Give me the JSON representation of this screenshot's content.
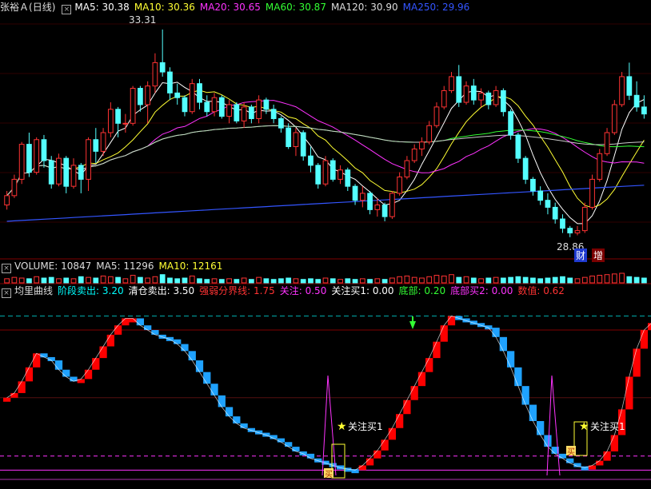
{
  "price_panel": {
    "symbol": "张裕Ａ",
    "period": "(日线)",
    "ma": [
      {
        "label": "MA5: 30.38",
        "color": "#ffffff"
      },
      {
        "label": "MA10: 30.36",
        "color": "#ffff33"
      },
      {
        "label": "MA20: 30.65",
        "color": "#ff33ff"
      },
      {
        "label": "MA60: 30.87",
        "color": "#33ff33"
      },
      {
        "label": "MA120: 30.90",
        "color": "#dddddd"
      },
      {
        "label": "MA250: 29.96",
        "color": "#3355ff"
      }
    ],
    "high_label": "33.31",
    "low_label": "28.86",
    "tag_cai": "财",
    "tag_zeng": "增"
  },
  "volume_panel": {
    "items": [
      {
        "label": "VOLUME: 10847",
        "color": "#dddddd"
      },
      {
        "label": "MA5: 11296",
        "color": "#dddddd"
      },
      {
        "label": "MA10: 12161",
        "color": "#ffff33"
      }
    ]
  },
  "indicator_panel": {
    "items": [
      {
        "label": "均里曲线",
        "color": "#dddddd"
      },
      {
        "label": "阶段卖出: 3.20",
        "color": "#00ffff"
      },
      {
        "label": "清仓卖出: 3.50",
        "color": "#ffffff"
      },
      {
        "label": "强弱分界线: 1.75",
        "color": "#ff3333"
      },
      {
        "label": "关注: 0.50",
        "color": "#ff33ff"
      },
      {
        "label": "关注买1: 0.00",
        "color": "#ffffff"
      },
      {
        "label": "底部: 0.20",
        "color": "#33ff33"
      },
      {
        "label": "底部买2: 0.00",
        "color": "#ff33ff"
      },
      {
        "label": "数值: 0.62",
        "color": "#ff3333"
      }
    ],
    "signal_label": "关注买1",
    "buy_mark": "买"
  },
  "colors": {
    "up": "#ff3333",
    "down": "#54ffff",
    "ind_up": "#ff0000",
    "ind_down": "#1fa2ff",
    "grid": "#800000",
    "dash": "#00aaaa"
  },
  "chart_data": {
    "type": "candlestick",
    "ohlc": [
      [
        29.55,
        29.85,
        29.45,
        29.75
      ],
      [
        29.75,
        30.2,
        29.7,
        30.1
      ],
      [
        30.1,
        30.9,
        30.0,
        30.85
      ],
      [
        30.85,
        31.1,
        30.15,
        30.25
      ],
      [
        30.25,
        31.0,
        30.2,
        30.95
      ],
      [
        30.95,
        31.05,
        30.35,
        30.5
      ],
      [
        30.5,
        30.6,
        29.9,
        30.0
      ],
      [
        30.0,
        30.65,
        29.95,
        30.55
      ],
      [
        30.55,
        30.6,
        29.8,
        29.95
      ],
      [
        29.95,
        30.55,
        29.9,
        30.4
      ],
      [
        30.4,
        30.45,
        29.8,
        30.1
      ],
      [
        30.1,
        31.0,
        29.85,
        30.95
      ],
      [
        30.95,
        31.2,
        30.45,
        30.7
      ],
      [
        30.7,
        31.2,
        30.6,
        31.1
      ],
      [
        31.1,
        31.75,
        31.0,
        31.6
      ],
      [
        31.6,
        31.65,
        31.0,
        31.3
      ],
      [
        31.3,
        31.5,
        31.1,
        31.3
      ],
      [
        31.3,
        32.1,
        31.25,
        32.05
      ],
      [
        32.05,
        32.1,
        31.55,
        31.7
      ],
      [
        31.7,
        32.2,
        31.3,
        32.1
      ],
      [
        32.1,
        32.8,
        31.95,
        32.6
      ],
      [
        32.6,
        33.31,
        32.3,
        32.4
      ],
      [
        32.4,
        32.5,
        31.8,
        31.95
      ],
      [
        31.95,
        32.15,
        31.7,
        31.85
      ],
      [
        31.85,
        31.9,
        31.45,
        31.55
      ],
      [
        31.55,
        32.25,
        31.5,
        32.15
      ],
      [
        32.15,
        32.25,
        31.6,
        31.75
      ],
      [
        31.75,
        31.9,
        31.45,
        31.55
      ],
      [
        31.55,
        31.95,
        31.45,
        31.85
      ],
      [
        31.85,
        31.9,
        31.4,
        31.45
      ],
      [
        31.45,
        31.8,
        31.3,
        31.7
      ],
      [
        31.7,
        31.75,
        31.3,
        31.35
      ],
      [
        31.35,
        31.75,
        31.2,
        31.65
      ],
      [
        31.65,
        31.7,
        31.3,
        31.4
      ],
      [
        31.4,
        31.9,
        31.3,
        31.8
      ],
      [
        31.8,
        31.85,
        31.5,
        31.6
      ],
      [
        31.6,
        31.7,
        31.3,
        31.4
      ],
      [
        31.4,
        31.45,
        31.1,
        31.2
      ],
      [
        31.2,
        31.3,
        30.75,
        30.8
      ],
      [
        30.8,
        31.2,
        30.6,
        31.1
      ],
      [
        31.1,
        31.15,
        30.5,
        30.6
      ],
      [
        30.6,
        30.8,
        30.25,
        30.4
      ],
      [
        30.4,
        30.45,
        29.9,
        30.0
      ],
      [
        30.0,
        30.6,
        29.95,
        30.5
      ],
      [
        30.5,
        30.55,
        30.05,
        30.1
      ],
      [
        30.1,
        30.4,
        30.0,
        30.3
      ],
      [
        30.3,
        30.35,
        29.85,
        29.95
      ],
      [
        29.95,
        30.0,
        29.55,
        29.65
      ],
      [
        29.65,
        29.95,
        29.5,
        29.8
      ],
      [
        29.8,
        29.85,
        29.35,
        29.45
      ],
      [
        29.45,
        29.7,
        29.3,
        29.55
      ],
      [
        29.55,
        29.6,
        29.2,
        29.3
      ],
      [
        29.3,
        29.85,
        29.25,
        29.8
      ],
      [
        29.8,
        30.25,
        29.75,
        30.15
      ],
      [
        30.15,
        30.6,
        30.1,
        30.5
      ],
      [
        30.5,
        30.85,
        30.45,
        30.75
      ],
      [
        30.75,
        31.0,
        30.6,
        30.9
      ],
      [
        30.9,
        31.35,
        30.85,
        31.25
      ],
      [
        31.25,
        31.75,
        31.2,
        31.65
      ],
      [
        31.65,
        32.1,
        31.6,
        32.0
      ],
      [
        32.0,
        32.4,
        31.95,
        32.3
      ],
      [
        32.3,
        32.55,
        31.65,
        31.75
      ],
      [
        31.75,
        32.2,
        31.7,
        32.1
      ],
      [
        32.1,
        32.25,
        31.7,
        31.8
      ],
      [
        31.8,
        32.05,
        31.65,
        31.95
      ],
      [
        31.95,
        32.0,
        31.6,
        31.7
      ],
      [
        31.7,
        32.1,
        31.65,
        32.0
      ],
      [
        32.0,
        32.05,
        31.45,
        31.55
      ],
      [
        31.55,
        31.6,
        30.95,
        31.05
      ],
      [
        31.05,
        31.1,
        30.45,
        30.55
      ],
      [
        30.55,
        30.6,
        30.0,
        30.1
      ],
      [
        30.1,
        30.15,
        29.75,
        29.85
      ],
      [
        29.85,
        29.95,
        29.55,
        29.65
      ],
      [
        29.65,
        29.8,
        29.35,
        29.5
      ],
      [
        29.5,
        29.6,
        29.15,
        29.25
      ],
      [
        29.25,
        29.35,
        28.95,
        29.05
      ],
      [
        29.05,
        29.1,
        28.86,
        28.95
      ],
      [
        28.95,
        29.1,
        28.9,
        29.0
      ],
      [
        29.0,
        29.6,
        28.95,
        29.5
      ],
      [
        29.5,
        30.2,
        29.45,
        30.1
      ],
      [
        30.1,
        30.75,
        30.05,
        30.65
      ],
      [
        30.65,
        31.2,
        30.6,
        31.1
      ],
      [
        31.1,
        31.8,
        31.05,
        31.7
      ],
      [
        31.7,
        32.4,
        31.65,
        32.3
      ],
      [
        32.3,
        32.6,
        31.8,
        31.9
      ],
      [
        31.9,
        32.2,
        31.55,
        31.65
      ],
      [
        31.65,
        31.9,
        31.4,
        31.5
      ]
    ],
    "volume": [
      6,
      8,
      7,
      6,
      9,
      7,
      8,
      6,
      7,
      6,
      9,
      8,
      7,
      10,
      9,
      8,
      6,
      11,
      8,
      7,
      9,
      12,
      7,
      6,
      7,
      10,
      6,
      5,
      6,
      5,
      6,
      5,
      7,
      5,
      8,
      6,
      5,
      6,
      7,
      6,
      5,
      6,
      5,
      7,
      6,
      5,
      6,
      5,
      6,
      5,
      6,
      5,
      7,
      9,
      10,
      8,
      7,
      9,
      11,
      10,
      12,
      8,
      9,
      7,
      6,
      7,
      8,
      7,
      8,
      9,
      8,
      7,
      6,
      7,
      8,
      9,
      7,
      6,
      8,
      10,
      11,
      12,
      13,
      14,
      9,
      8,
      7
    ],
    "indicator": [
      1.75,
      1.85,
      2.1,
      2.4,
      2.7,
      2.62,
      2.55,
      2.35,
      2.2,
      2.1,
      2.15,
      2.35,
      2.6,
      2.85,
      3.1,
      3.3,
      3.45,
      3.45,
      3.3,
      3.2,
      3.1,
      3.05,
      3.0,
      2.9,
      2.75,
      2.55,
      2.3,
      2.05,
      1.8,
      1.55,
      1.35,
      1.2,
      1.1,
      1.05,
      1.0,
      0.95,
      0.88,
      0.8,
      0.7,
      0.6,
      0.55,
      0.45,
      0.4,
      0.35,
      0.3,
      0.25,
      0.22,
      0.2,
      0.3,
      0.45,
      0.62,
      0.85,
      1.1,
      1.4,
      1.7,
      2.0,
      2.3,
      2.6,
      2.95,
      3.3,
      3.5,
      3.45,
      3.4,
      3.35,
      3.3,
      3.25,
      3.05,
      2.75,
      2.4,
      2.0,
      1.6,
      1.25,
      0.95,
      0.7,
      0.55,
      0.45,
      0.35,
      0.28,
      0.25,
      0.3,
      0.4,
      0.6,
      0.95,
      1.5,
      2.2,
      2.8,
      3.2,
      3.35,
      3.25,
      3.15
    ]
  }
}
